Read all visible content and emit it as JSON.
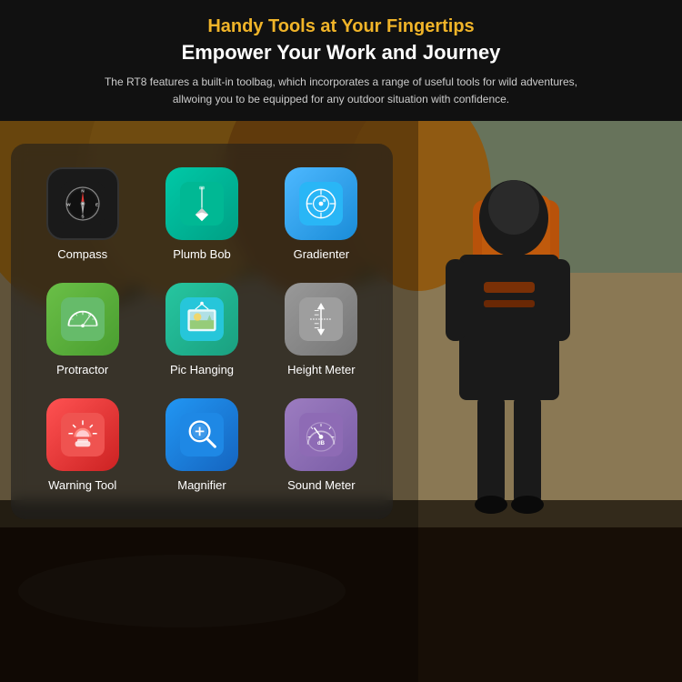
{
  "header": {
    "subtitle": "Handy Tools at Your Fingertips",
    "title": "Empower Your Work and Journey",
    "description": "The RT8 features a built-in toolbag, which incorporates a range of useful tools for wild adventures, allwoing you to be equipped for any outdoor situation with confidence."
  },
  "tools": [
    {
      "id": "compass",
      "label": "Compass",
      "icon_type": "compass"
    },
    {
      "id": "plumb-bob",
      "label": "Plumb Bob",
      "icon_type": "plumb"
    },
    {
      "id": "gradienter",
      "label": "Gradienter",
      "icon_type": "gradienter"
    },
    {
      "id": "protractor",
      "label": "Protractor",
      "icon_type": "protractor"
    },
    {
      "id": "pic-hanging",
      "label": "Pic Hanging",
      "icon_type": "pichanging"
    },
    {
      "id": "height-meter",
      "label": "Height Meter",
      "icon_type": "heightmeter"
    },
    {
      "id": "warning-tool",
      "label": "Warning Tool",
      "icon_type": "warning"
    },
    {
      "id": "magnifier",
      "label": "Magnifier",
      "icon_type": "magnifier"
    },
    {
      "id": "sound-meter",
      "label": "Sound Meter",
      "icon_type": "soundmeter"
    }
  ],
  "colors": {
    "accent": "#f0b429",
    "background": "#111111"
  }
}
